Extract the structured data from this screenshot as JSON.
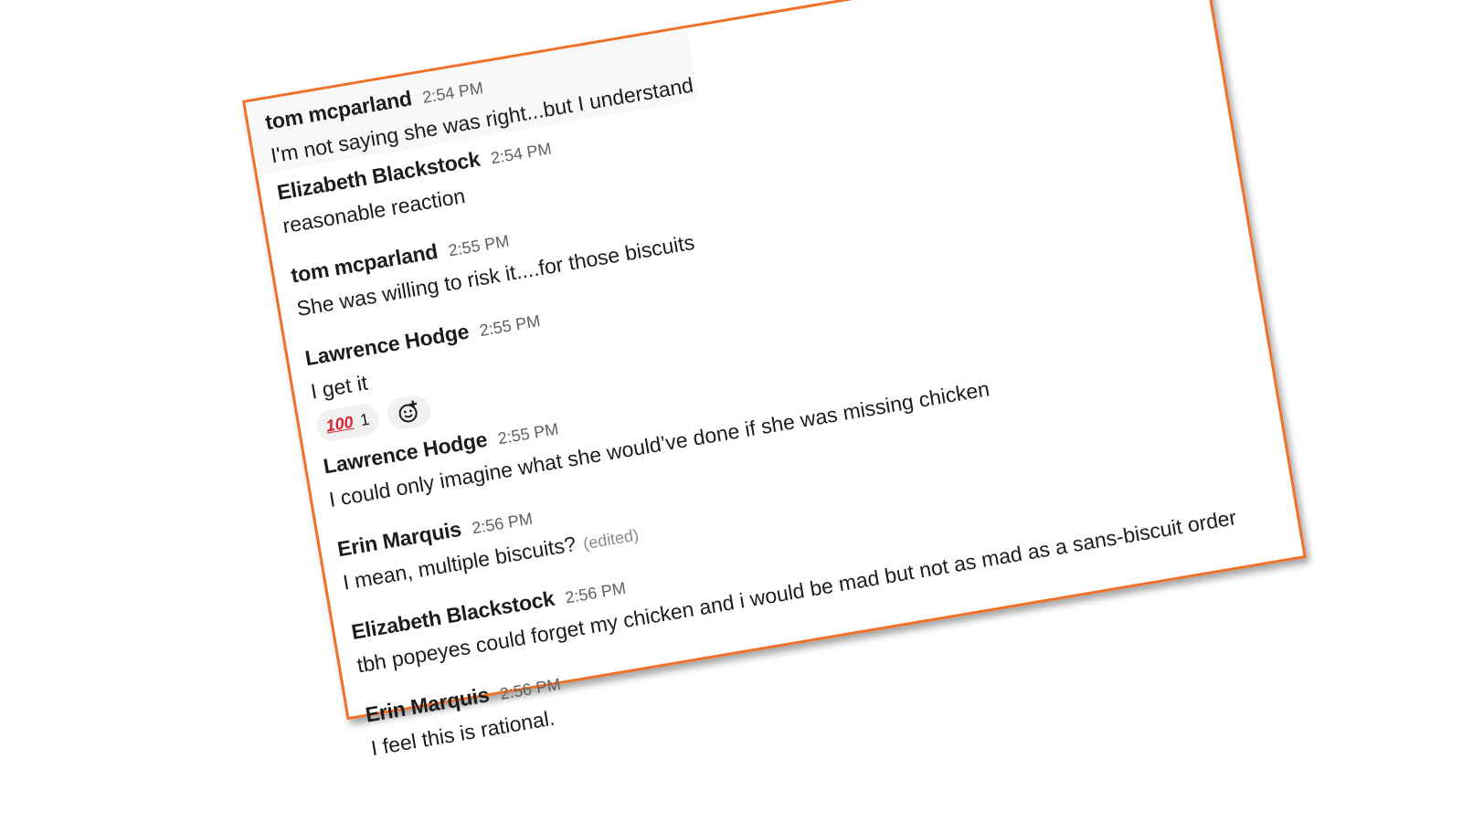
{
  "colors": {
    "frame_border": "#f0702a",
    "author": "#1d1c1d",
    "timestamp": "#616061",
    "edited": "#8a8a8a",
    "reaction_bg": "#f1f1f1",
    "hundred_emoji": "#d9232e"
  },
  "messages": [
    {
      "author": "tom mcparland",
      "time": "2:54 PM",
      "text": "I'm not saying she was right...but I understand"
    },
    {
      "author": "Elizabeth Blackstock",
      "time": "2:54 PM",
      "text": "reasonable reaction"
    },
    {
      "author": "tom mcparland",
      "time": "2:55 PM",
      "text": "She was willing to risk it....for those biscuits"
    },
    {
      "author": "Lawrence Hodge",
      "time": "2:55 PM",
      "text": "I get it",
      "reaction": {
        "emoji": "100",
        "emoji_name": "hundred-points-icon",
        "count": "1"
      }
    },
    {
      "author": "Lawrence Hodge",
      "time": "2:55 PM",
      "text": "I could only imagine what she would’ve done if she was missing chicken"
    },
    {
      "author": "Erin Marquis",
      "time": "2:56 PM",
      "text": "I mean, multiple biscuits?",
      "edited": "(edited)"
    },
    {
      "author": "Elizabeth Blackstock",
      "time": "2:56 PM",
      "text": "tbh popeyes could forget my chicken and i would be mad but not as mad as a sans-biscuit order"
    },
    {
      "author": "Erin Marquis",
      "time": "2:56 PM",
      "text": "I feel this is rational."
    }
  ]
}
